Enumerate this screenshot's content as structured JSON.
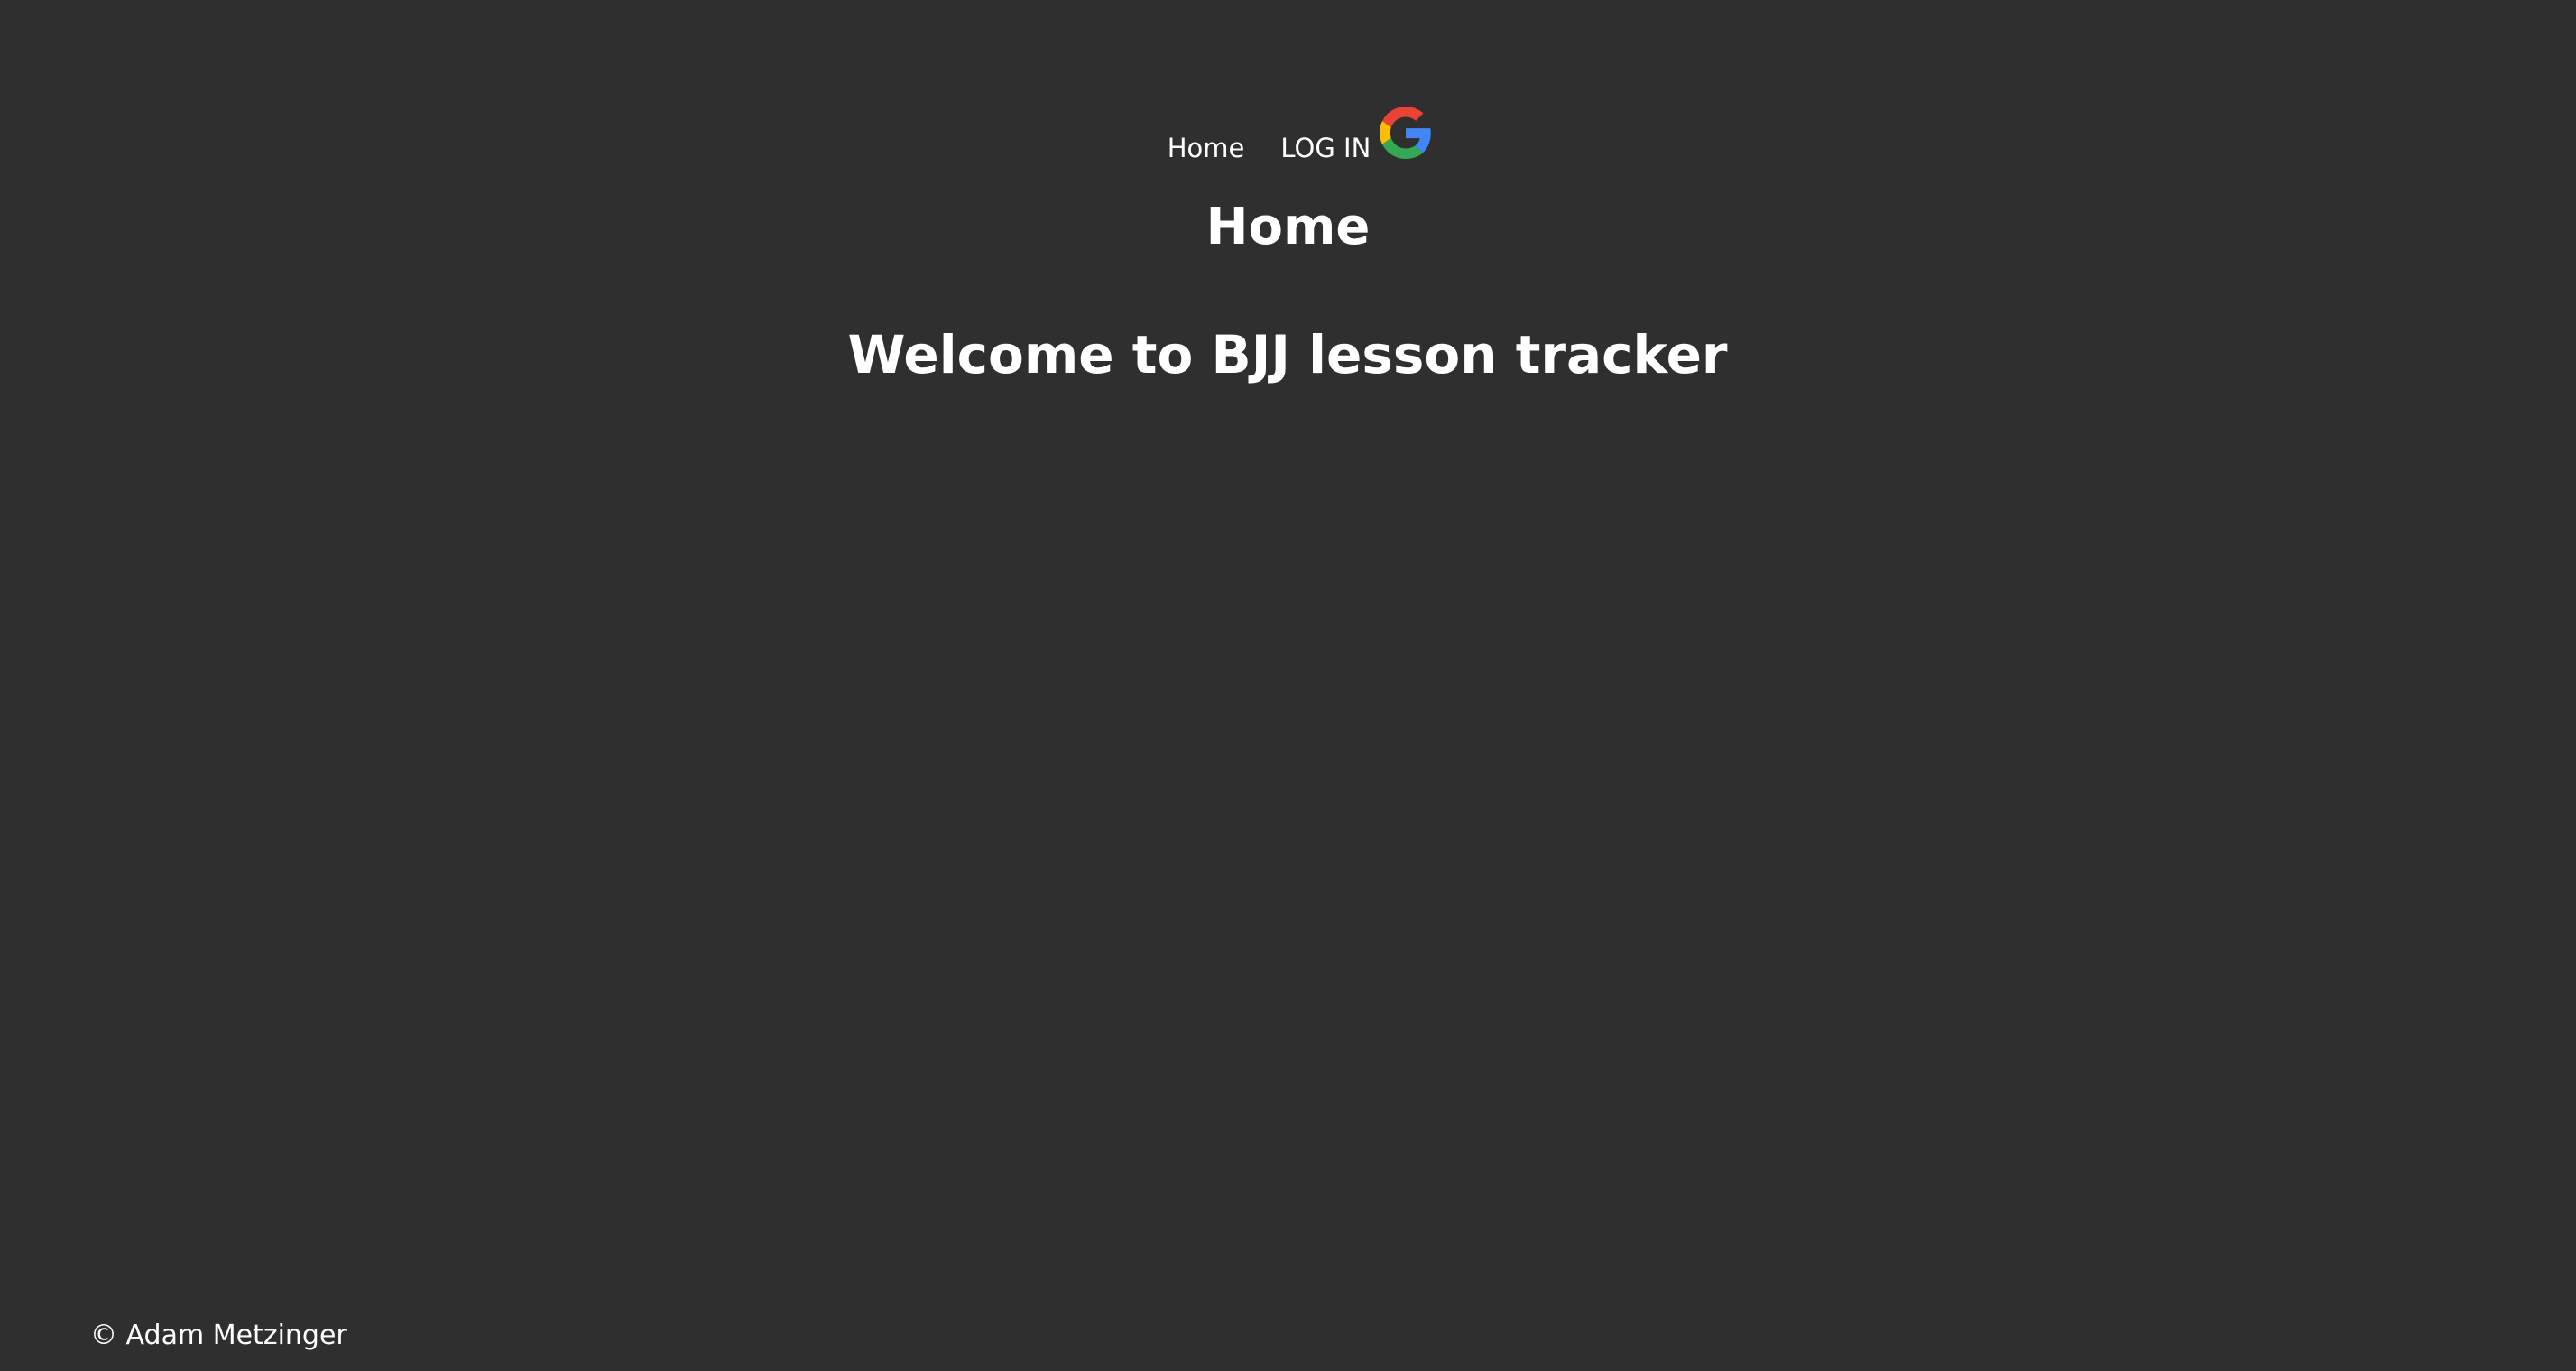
{
  "nav": {
    "home_label": "Home",
    "login_label": "LOG IN",
    "login_icon": "google-icon"
  },
  "main": {
    "page_title": "Home",
    "welcome_text": "Welcome to BJJ lesson tracker"
  },
  "footer": {
    "copyright": "© Adam Metzinger"
  },
  "colors": {
    "background": "#2f2f2f",
    "text": "#ffffff",
    "google_red": "#ea4335",
    "google_yellow": "#fbbc05",
    "google_green": "#34a853",
    "google_blue": "#4285f4"
  }
}
